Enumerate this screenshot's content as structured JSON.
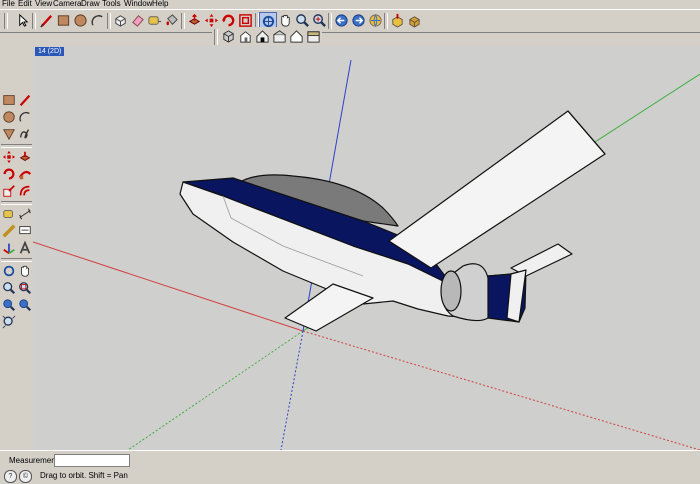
{
  "menu": [
    "File",
    "Edit",
    "View",
    "Camera",
    "Draw",
    "Tools",
    "Window",
    "Help"
  ],
  "toolbar": {
    "main_icons": [
      "select-icon",
      "line-icon",
      "rectangle-icon",
      "circle-icon",
      "arc-icon",
      "make-component-icon",
      "eraser-icon",
      "tape-measure-icon",
      "paint-bucket-icon",
      "push-pull-icon",
      "move-icon",
      "rotate-icon",
      "offset-icon",
      "orbit-icon",
      "pan-icon",
      "zoom-icon",
      "zoom-extents-icon",
      "previous-view-icon",
      "next-view-icon",
      "get-models-icon",
      "share-model-icon"
    ],
    "view_icons": [
      "iso-view-icon",
      "top-view-icon",
      "front-view-icon",
      "right-view-icon",
      "back-view-icon",
      "left-view-icon"
    ]
  },
  "scene": {
    "tab_label": "14 (2D)"
  },
  "status": {
    "measurements_label": "Measurements",
    "measurements_value": "",
    "hint": "Drag to orbit.  Shift = Pan"
  },
  "colors": {
    "axis_red": "#d04040",
    "axis_green": "#3fae3f",
    "axis_blue": "#3040c8",
    "fuselage_blue": "#0a1560",
    "canopy": "#7a7a7a",
    "background": "#cfcfcd"
  }
}
